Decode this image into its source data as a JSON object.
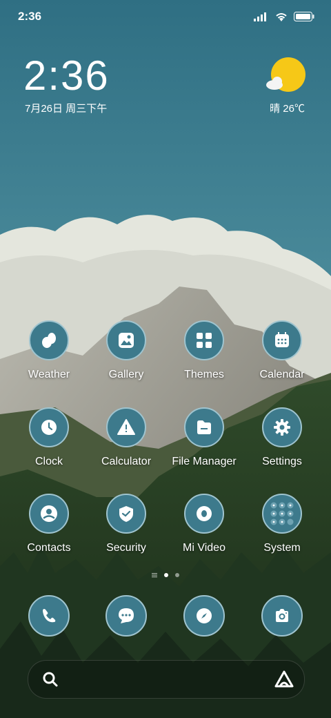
{
  "status_bar": {
    "time": "2:36",
    "icons": [
      "signal-icon",
      "wifi-icon",
      "battery-icon"
    ]
  },
  "clock_widget": {
    "time": "2:36",
    "date": "7月26日 周三下午"
  },
  "weather_widget": {
    "icon": "sun-cloud-icon",
    "text": "晴 26℃"
  },
  "apps": [
    {
      "label": "Weather",
      "icon": "weather-icon"
    },
    {
      "label": "Gallery",
      "icon": "gallery-icon"
    },
    {
      "label": "Themes",
      "icon": "themes-icon"
    },
    {
      "label": "Calendar",
      "icon": "calendar-icon"
    },
    {
      "label": "Clock",
      "icon": "clock-icon"
    },
    {
      "label": "Calculator",
      "icon": "calculator-icon"
    },
    {
      "label": "File Manager",
      "icon": "file-manager-icon"
    },
    {
      "label": "Settings",
      "icon": "settings-icon"
    },
    {
      "label": "Contacts",
      "icon": "contacts-icon"
    },
    {
      "label": "Security",
      "icon": "security-icon"
    },
    {
      "label": "Mi Video",
      "icon": "mi-video-icon"
    },
    {
      "label": "System",
      "icon": "system-folder-icon"
    }
  ],
  "page_indicator": {
    "pages": 2,
    "current": 1
  },
  "dock": [
    "phone-icon",
    "messages-icon",
    "browser-icon",
    "camera-icon"
  ],
  "search_bar": {
    "left_icon": "search-icon",
    "right_icon": "assistant-icon"
  },
  "colors": {
    "icon_bg": "#3d7a8c",
    "icon_border": "#9fc4cf",
    "sky": "#3f7f91"
  }
}
